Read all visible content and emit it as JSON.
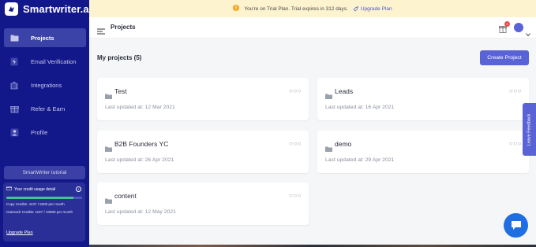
{
  "app": {
    "name": "Smartwriter.ai"
  },
  "sidebar": {
    "items": [
      {
        "label": "Projects",
        "icon": "folder-icon",
        "active": true
      },
      {
        "label": "Email Verification",
        "icon": "lightning-icon",
        "active": false
      },
      {
        "label": "Integrations",
        "icon": "puzzle-icon",
        "active": false
      },
      {
        "label": "Refer & Earn",
        "icon": "gift-icon",
        "active": false
      },
      {
        "label": "Profile",
        "icon": "user-icon",
        "active": false
      }
    ],
    "tutorial_label": "SmartWriter tutorial",
    "credits": {
      "title": "Your credit usage detail",
      "progress": 0.887,
      "copy_credits": "Copy Credits: 4437 / 5000 per month",
      "outreach_credits": "Outreach Credits: 1197 / 10000 per month",
      "upgrade_label": "Upgrade Plan"
    }
  },
  "banner": {
    "text": "You're on Trial Plan. Trial expires in 312 days.",
    "link_label": "Upgrade Plan"
  },
  "topbar": {
    "title": "Projects",
    "notification_count": "0"
  },
  "main": {
    "section_title": "My projects (5)",
    "create_label": "Create Project",
    "projects": [
      {
        "name": "Test",
        "updated": "Last updated at: 12 Mar 2021"
      },
      {
        "name": "Leads",
        "updated": "Last updated at: 16 Apr 2021"
      },
      {
        "name": "B2B Founders YC",
        "updated": "Last updated at: 26 Apr 2021"
      },
      {
        "name": "demo",
        "updated": "Last updated at: 29 Apr 2021"
      },
      {
        "name": "content",
        "updated": "Last updated at: 12 May 2021"
      }
    ]
  },
  "feedback_label": "Leave Feedback",
  "colors": {
    "sidebar": "#12178a",
    "accent": "#5a63d6",
    "banner": "#fdf3cf",
    "chat": "#1f6fe0"
  }
}
